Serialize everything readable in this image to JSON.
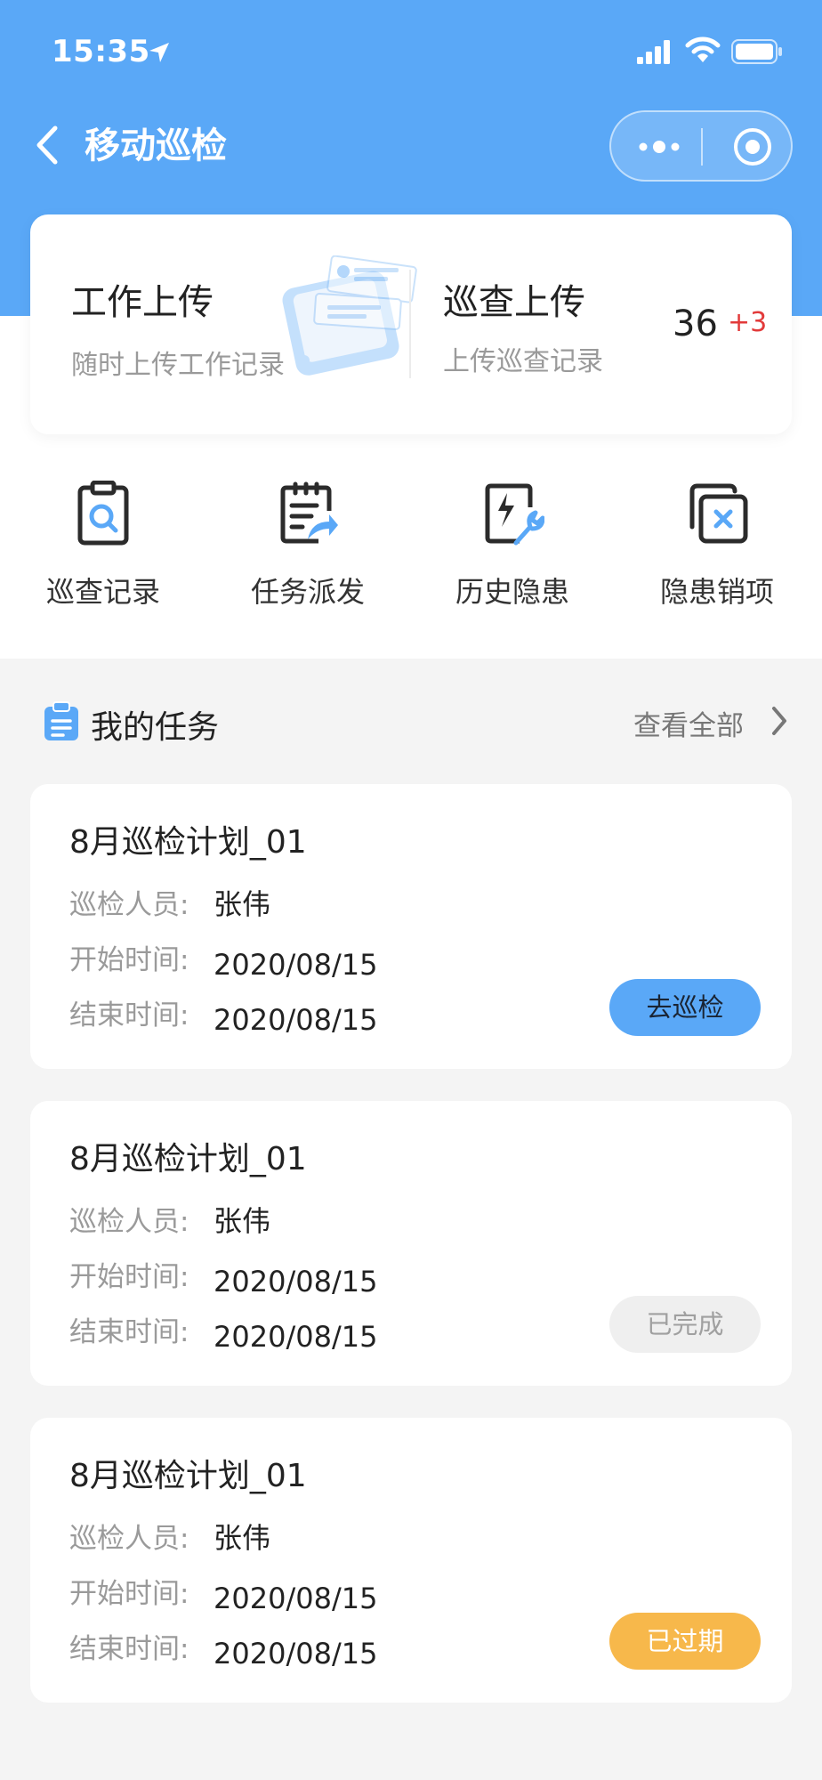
{
  "status_bar": {
    "time": "15:35"
  },
  "nav": {
    "title": "移动巡检"
  },
  "upload_card": {
    "work_title": "工作上传",
    "work_subtitle": "随时上传工作记录",
    "patrol_title": "巡查上传",
    "patrol_subtitle": "上传巡查记录",
    "count": "36",
    "count_delta": "+3"
  },
  "menu": [
    {
      "label": "巡查记录",
      "icon": "clipboard-search-icon"
    },
    {
      "label": "任务派发",
      "icon": "task-dispatch-icon"
    },
    {
      "label": "历史隐患",
      "icon": "history-hazard-icon"
    },
    {
      "label": "隐患销项",
      "icon": "hazard-close-icon"
    }
  ],
  "section": {
    "title": "我的任务",
    "view_all": "查看全部"
  },
  "labels": {
    "inspector": "巡检人员:",
    "start": "开始时间:",
    "end": "结束时间:"
  },
  "tasks": [
    {
      "title": "8月巡检计划_01",
      "inspector": "张伟",
      "start": "2020/08/15",
      "end": "2020/08/15",
      "button": "去巡检",
      "status": "go"
    },
    {
      "title": "8月巡检计划_01",
      "inspector": "张伟",
      "start": "2020/08/15",
      "end": "2020/08/15",
      "button": "已完成",
      "status": "done"
    },
    {
      "title": "8月巡检计划_01",
      "inspector": "张伟",
      "start": "2020/08/15",
      "end": "2020/08/15",
      "button": "已过期",
      "status": "expired"
    }
  ],
  "colors": {
    "primary": "#5aa8f7",
    "accent_red": "#e23a3a",
    "expired": "#f7b84b",
    "done_bg": "#efefef"
  }
}
